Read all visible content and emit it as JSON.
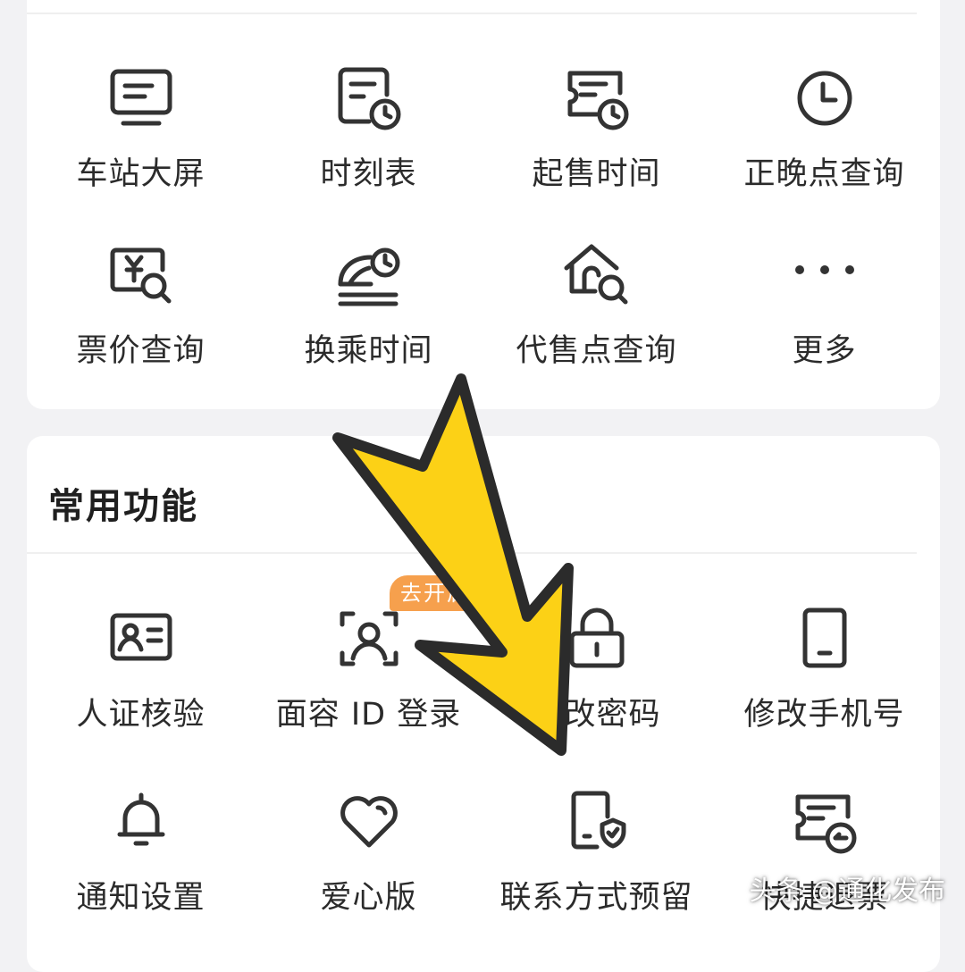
{
  "top_grid": {
    "items": [
      {
        "label": "车站大屏",
        "icon": "monitor-icon"
      },
      {
        "label": "时刻表",
        "icon": "timetable-clock-icon"
      },
      {
        "label": "起售时间",
        "icon": "ticket-clock-icon"
      },
      {
        "label": "正晚点查询",
        "icon": "clock-icon"
      },
      {
        "label": "票价查询",
        "icon": "yuan-search-icon"
      },
      {
        "label": "换乘时间",
        "icon": "train-clock-icon"
      },
      {
        "label": "代售点查询",
        "icon": "house-search-icon"
      },
      {
        "label": "更多",
        "icon": "more-dots-icon"
      }
    ]
  },
  "common": {
    "title": "常用功能",
    "badge": "去开启",
    "items": [
      {
        "label": "人证核验",
        "icon": "id-card-icon"
      },
      {
        "label": "面容 ID 登录",
        "icon": "face-id-icon"
      },
      {
        "label": "修改密码",
        "icon": "lock-icon"
      },
      {
        "label": "修改手机号",
        "icon": "phone-icon"
      },
      {
        "label": "通知设置",
        "icon": "bell-icon"
      },
      {
        "label": "爱心版",
        "icon": "heart-icon"
      },
      {
        "label": "联系方式预留",
        "icon": "phone-shield-icon"
      },
      {
        "label": "快捷退票",
        "icon": "ticket-return-icon"
      }
    ]
  },
  "overlay": {
    "arrow_color": "#fcd116",
    "arrow_outline": "#2b2b2b",
    "watermark": "头条 @通化发布"
  },
  "colors": {
    "icon_stroke": "#333333",
    "badge": "#f6a04d",
    "card": "#ffffff",
    "background": "#f2f2f4"
  }
}
